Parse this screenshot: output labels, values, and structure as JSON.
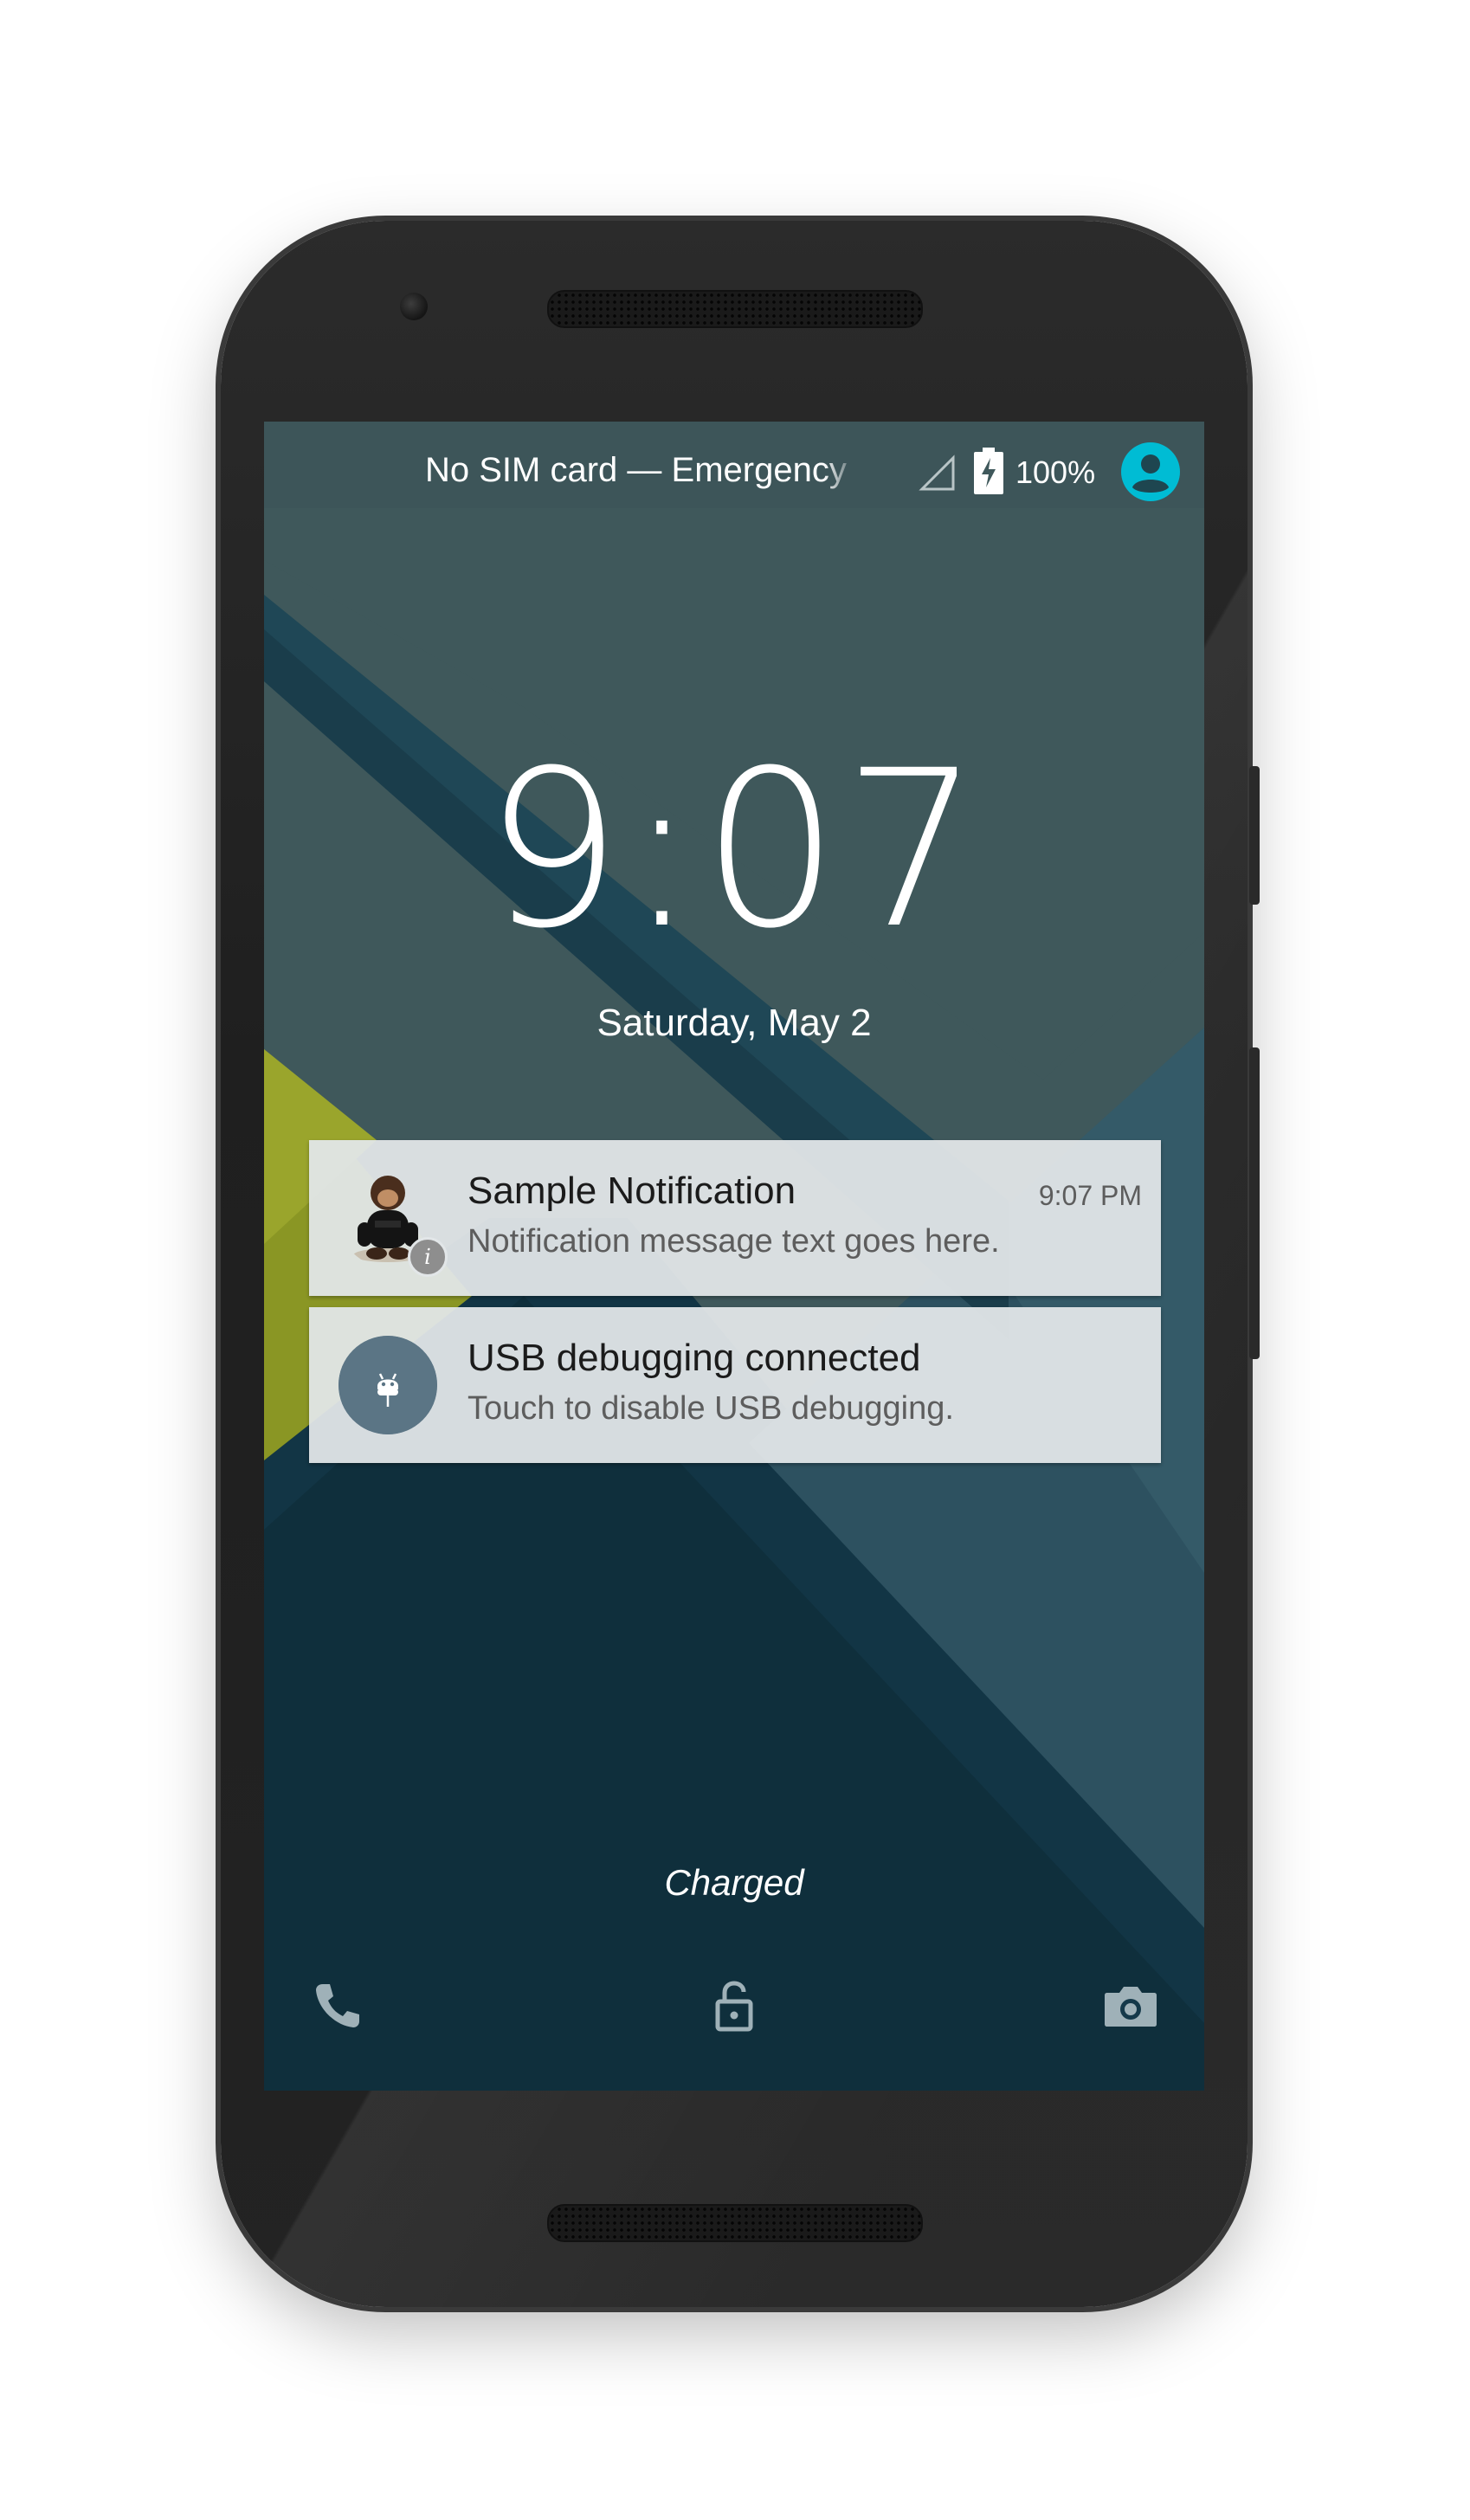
{
  "status_bar": {
    "carrier": "No SIM card — Emergency",
    "battery": "100%"
  },
  "lockscreen": {
    "time": "9:07",
    "date": "Saturday, May 2",
    "charging_status": "Charged"
  },
  "notifications": [
    {
      "title": "Sample Notification",
      "text": "Notification message text goes here.",
      "time": "9:07 PM"
    },
    {
      "title": "USB debugging connected",
      "text": "Touch to disable USB debugging."
    }
  ],
  "icons": {
    "signal": "signal-no-sim-icon",
    "battery": "battery-charging-icon",
    "user": "user-avatar-icon",
    "phone": "phone-icon",
    "lock": "unlock-icon",
    "camera": "camera-icon",
    "usb": "android-debug-icon",
    "info_badge": "info-icon"
  },
  "colors": {
    "accent": "#00bcd4",
    "wallpaper_base": "#3f585b",
    "wallpaper_dark": "#0e2f3b",
    "wallpaper_band": "#1f4756",
    "wallpaper_yellow": "#8a9624",
    "notification_bg": "#e2e6e8",
    "usb_icon_bg": "#5b7585"
  }
}
